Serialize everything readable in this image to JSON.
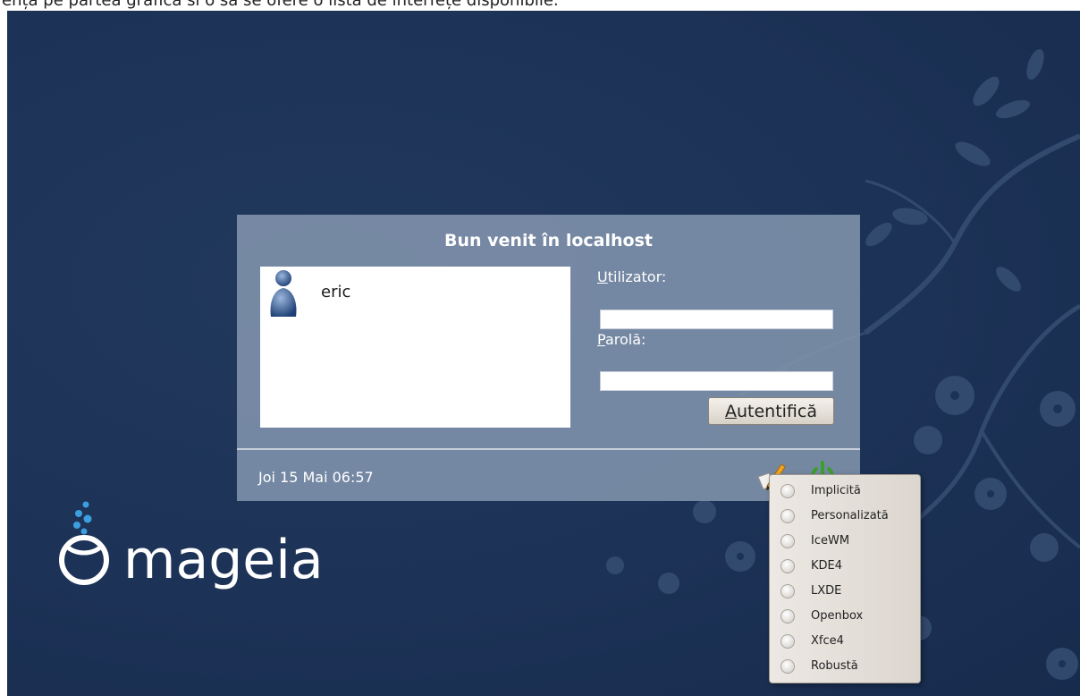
{
  "caption": "ență pe partea grafică si o să se ofere o listă de interfețe disponibile.",
  "login": {
    "welcome": "Bun venit în localhost",
    "users": [
      {
        "name": "eric"
      }
    ],
    "username_label_mnemonic": "U",
    "username_label_rest": "tilizator:",
    "username_value": "",
    "password_label_mnemonic": "P",
    "password_label_rest": "arolă:",
    "password_value": "",
    "login_button_mnemonic": "A",
    "login_button_rest": "utentifică",
    "clock": "Joi 15 Mai 06:57"
  },
  "logo": {
    "text": "mageia"
  },
  "session_menu": {
    "items": [
      {
        "label": "Implicită"
      },
      {
        "label": "Personalizată"
      },
      {
        "label": "IceWM"
      },
      {
        "label": "KDE4"
      },
      {
        "label": "LXDE"
      },
      {
        "label": "Openbox"
      },
      {
        "label": "Xfce4"
      },
      {
        "label": "Robustă"
      }
    ]
  },
  "colors": {
    "desktop_background": "#1c3256",
    "panel_background": "#8294ad",
    "power_icon": "#3aa02c",
    "logo_accent": "#3b9fe0"
  },
  "icons": [
    "user-avatar-icon",
    "session-select-icon",
    "power-icon",
    "mageia-logo"
  ]
}
